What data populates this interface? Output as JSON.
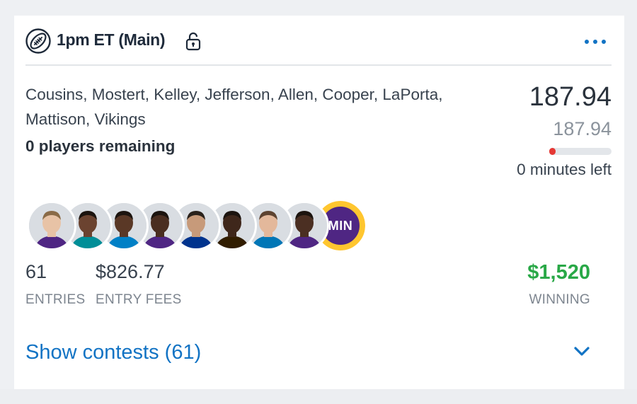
{
  "header": {
    "title": "1pm ET (Main)",
    "icons": [
      "football-icon",
      "lock-icon",
      "more-dots-icon"
    ]
  },
  "lineup": {
    "players_text": "Cousins, Mostert, Kelley, Jefferson, Allen, Cooper, LaPorta, Mattison, Vikings",
    "remaining": "0 players remaining"
  },
  "score": {
    "actual": "187.94",
    "projected": "187.94",
    "progress_fraction": 0.02,
    "time_left": "0 minutes left"
  },
  "avatars": [
    {
      "name": "Cousins",
      "jersey": "#4f2683"
    },
    {
      "name": "Mostert",
      "jersey": "#008e97"
    },
    {
      "name": "Kelley",
      "jersey": "#0080c6"
    },
    {
      "name": "Jefferson",
      "jersey": "#4f2683"
    },
    {
      "name": "Allen",
      "jersey": "#00338d"
    },
    {
      "name": "Cooper",
      "jersey": "#311d00"
    },
    {
      "name": "LaPorta",
      "jersey": "#0076b6"
    },
    {
      "name": "Mattison",
      "jersey": "#4f2683"
    }
  ],
  "dst_badge": "MIN",
  "stats": {
    "entries_value": "61",
    "entries_label": "ENTRIES",
    "fees_value": "$826.77",
    "fees_label": "ENTRY FEES",
    "winning_value": "$1,520",
    "winning_label": "WINNING"
  },
  "footer": {
    "show_contests": "Show contests (61)"
  },
  "colors": {
    "accent": "#1273c4",
    "win": "#29a847",
    "progress": "#e53935"
  }
}
